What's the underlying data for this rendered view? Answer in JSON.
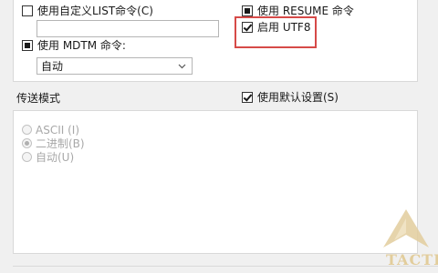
{
  "options": {
    "custom_list": {
      "label": "使用自定义LIST命令(C)",
      "value": ""
    },
    "resume": {
      "label": "使用 RESUME 命令"
    },
    "utf8": {
      "label": "启用 UTF8"
    },
    "mdtm": {
      "label": "使用 MDTM 命令:",
      "select_value": "自动"
    }
  },
  "transfer": {
    "title": "传送模式",
    "use_default": "使用默认设置(S)",
    "modes": [
      "ASCII (I)",
      "二进制(B)",
      "自动(U)"
    ],
    "selected": 1
  },
  "watermark": {
    "text": "TACTR",
    "color": "#e2cd9c"
  },
  "highlight_color": "#d64a48"
}
